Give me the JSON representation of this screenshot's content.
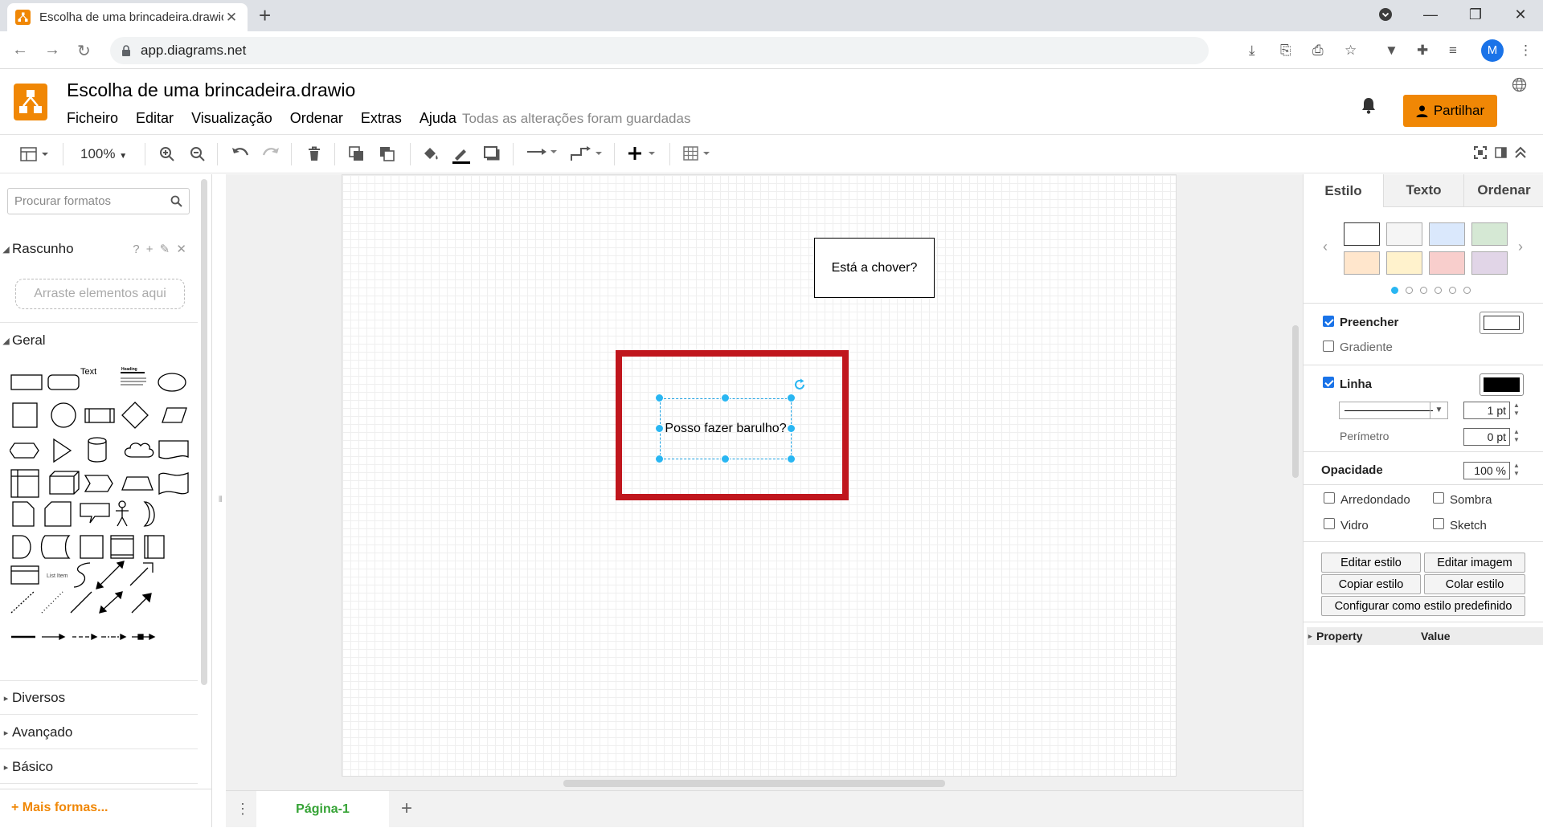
{
  "browser": {
    "tab_title": "Escolha de uma brincadeira.drawio",
    "url": "app.diagrams.net",
    "avatar_initial": "M"
  },
  "app": {
    "doc_title": "Escolha de uma brincadeira.drawio",
    "menus": [
      "Ficheiro",
      "Editar",
      "Visualização",
      "Ordenar",
      "Extras",
      "Ajuda"
    ],
    "status": "Todas as alterações foram guardadas",
    "share_label": "Partilhar"
  },
  "toolbar": {
    "zoom": "100%"
  },
  "left_panel": {
    "search_placeholder": "Procurar formatos",
    "scratchpad": "Rascunho",
    "scratchpad_icons": "? + ✎ ✕",
    "dropzone": "Arraste elementos aqui",
    "general": "Geral",
    "shape_text_label": "Text",
    "shape_heading_label": "Heading",
    "shape_listitem_label": "List Item",
    "sections": [
      "Diversos",
      "Avançado",
      "Básico"
    ],
    "more_shapes": "Mais formas..."
  },
  "canvas": {
    "shape1_label": "Está a chover?",
    "shape2_label": "Posso fazer barulho?",
    "highlight_color": "#c0161d",
    "selection_color": "#29b6f2"
  },
  "pages": {
    "tab": "Página-1"
  },
  "right_panel": {
    "tabs": [
      "Estilo",
      "Texto",
      "Ordenar"
    ],
    "swatches": [
      "#ffffff",
      "#f5f5f5",
      "#dae8fc",
      "#d5e8d4",
      "#ffe6cc",
      "#fff2cc",
      "#f8cecc",
      "#e1d5e7"
    ],
    "fill": {
      "label": "Preencher",
      "checked": true,
      "color": "#ffffff"
    },
    "gradient": {
      "label": "Gradiente",
      "checked": false
    },
    "line": {
      "label": "Linha",
      "checked": true,
      "color": "#000000",
      "width": "1 pt"
    },
    "perimeter": {
      "label": "Perímetro",
      "value": "0 pt"
    },
    "opacity": {
      "label": "Opacidade",
      "value": "100 %"
    },
    "options": {
      "rounded": "Arredondado",
      "shadow": "Sombra",
      "glass": "Vidro",
      "sketch": "Sketch"
    },
    "buttons": {
      "edit_style": "Editar estilo",
      "edit_image": "Editar imagem",
      "copy_style": "Copiar estilo",
      "paste_style": "Colar estilo",
      "default_style": "Configurar como estilo predefinido"
    },
    "table": {
      "property": "Property",
      "value": "Value"
    }
  }
}
